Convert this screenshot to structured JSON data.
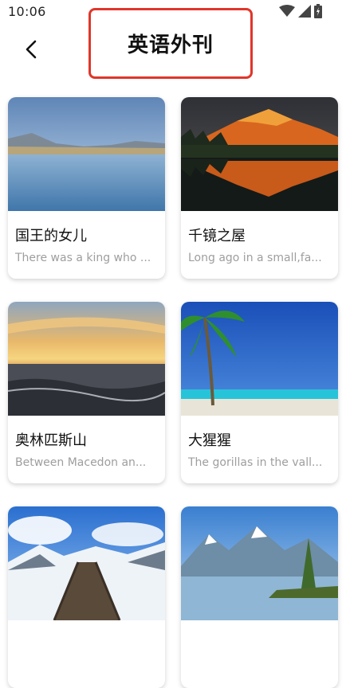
{
  "status_bar": {
    "time": "10:06"
  },
  "header": {
    "title": "英语外刊",
    "back_icon": "chevron-left-icon"
  },
  "articles": [
    {
      "title": "国王的女儿",
      "excerpt": "There was a king who ..."
    },
    {
      "title": "千镜之屋",
      "excerpt": "Long ago in a small,fa..."
    },
    {
      "title": "奥林匹斯山",
      "excerpt": "Between Macedon an..."
    },
    {
      "title": "大猩猩",
      "excerpt": "The gorillas in the vall..."
    },
    {
      "title": "",
      "excerpt": ""
    },
    {
      "title": "",
      "excerpt": ""
    }
  ]
}
